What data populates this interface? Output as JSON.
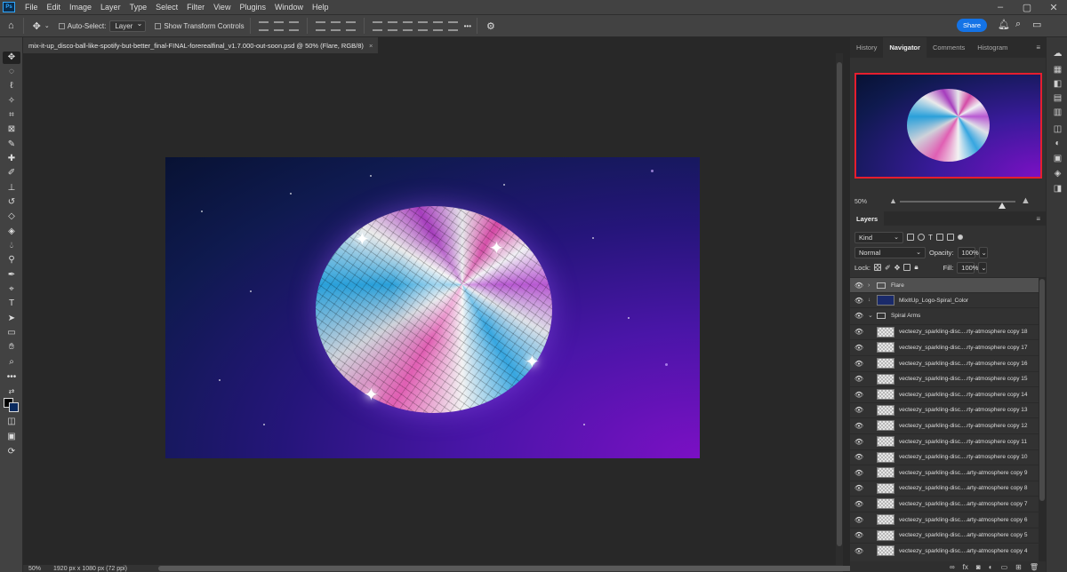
{
  "menubar": {
    "logo": "Ps",
    "items": [
      "File",
      "Edit",
      "Image",
      "Layer",
      "Type",
      "Select",
      "Filter",
      "View",
      "Plugins",
      "Window",
      "Help"
    ]
  },
  "options": {
    "auto_select_label": "Auto-Select:",
    "layer_dropdown": "Layer",
    "show_transform_label": "Show Transform Controls",
    "share_label": "Share"
  },
  "document": {
    "tab_title": "mix-it-up_disco-ball-like-spotify-but-better_final-FINAL-forerealfinal_v1.7.000-out-soon.psd @ 50% (Flare, RGB/8)",
    "close_icon": "×"
  },
  "status": {
    "zoom": "50%",
    "dims": "1920 px x 1080 px (72 ppi)"
  },
  "navigator": {
    "tabs": [
      "History",
      "Navigator",
      "Comments",
      "Histogram"
    ],
    "active_tab": "Navigator",
    "zoom": "50%",
    "zoom_level": 0.5
  },
  "layers": {
    "tab": "Layers",
    "filter": "Kind",
    "blend_mode": "Normal",
    "opacity_label": "Opacity:",
    "opacity": "100%",
    "lock_label": "Lock:",
    "fill_label": "Fill:",
    "fill": "100%",
    "items": [
      {
        "name": "Flare",
        "kind": "group"
      },
      {
        "name": "MixItUp_Logo-Spiral_Color",
        "kind": "smart"
      },
      {
        "name": "Spiral Arms",
        "kind": "group-open"
      },
      {
        "name": "vecteezy_sparkling-disc....rty-atmosphere copy 18"
      },
      {
        "name": "vecteezy_sparkling-disc....rty-atmosphere copy 17"
      },
      {
        "name": "vecteezy_sparkling-disc....rty-atmosphere copy 16"
      },
      {
        "name": "vecteezy_sparkling-disc....rty-atmosphere copy 15"
      },
      {
        "name": "vecteezy_sparkling-disc....rty-atmosphere copy 14"
      },
      {
        "name": "vecteezy_sparkling-disc....rty-atmosphere copy 13"
      },
      {
        "name": "vecteezy_sparkling-disc....rty-atmosphere copy 12"
      },
      {
        "name": "vecteezy_sparkling-disc....rty-atmosphere copy 11"
      },
      {
        "name": "vecteezy_sparkling-disc....rty-atmosphere copy 10"
      },
      {
        "name": "vecteezy_sparkling-disc....arty-atmosphere copy 9"
      },
      {
        "name": "vecteezy_sparkling-disc....arty-atmosphere copy 8"
      },
      {
        "name": "vecteezy_sparkling-disc....arty-atmosphere copy 7"
      },
      {
        "name": "vecteezy_sparkling-disc....arty-atmosphere copy 6"
      },
      {
        "name": "vecteezy_sparkling-disc....arty-atmosphere copy 5"
      },
      {
        "name": "vecteezy_sparkling-disc....arty-atmosphere copy 4"
      }
    ]
  },
  "colors": {
    "accent": "#1473e6",
    "nav_frame": "#e61e2e"
  }
}
